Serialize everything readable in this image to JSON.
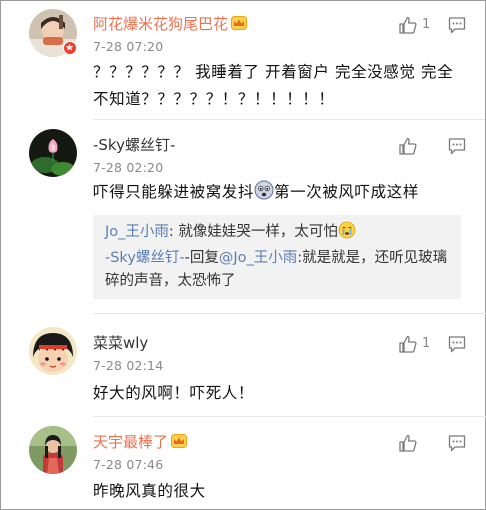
{
  "comments": [
    {
      "user": "阿花爆米花狗尾巴花",
      "time": "7-28 07:20",
      "text": "？？？？？？ 我睡着了 开着窗户 完全没感觉 完全不知道？？？？？！？！！！！！",
      "likes": "1",
      "name_color": "#eb7350"
    },
    {
      "user": "-Sky螺丝钉-",
      "time": "7-28 02:20",
      "text_before": "吓得只能躲进被窝发抖",
      "text_after": "第一次被风吓成这样",
      "likes": "",
      "replies": [
        {
          "user": "Jo_王小雨",
          "sep": ": ",
          "text": "就像娃娃哭一样，太可怕"
        },
        {
          "user": "-Sky螺丝钉-",
          "mid": "-回复",
          "target": "@Jo_王小雨",
          "text": ":就是就是，还听见玻璃碎的声音，太恐怖了"
        }
      ]
    },
    {
      "user": "菜菜wly",
      "time": "7-28 02:14",
      "text": "好大的风啊！吓死人！",
      "likes": "1"
    },
    {
      "user": "天宇最棒了",
      "time": "7-28 07:46",
      "text": "昨晚风真的很大",
      "likes": "",
      "name_color": "#eb7350"
    }
  ],
  "icons": {
    "like": "thumbs-up-icon",
    "reply": "comment-bubble-icon",
    "member": "crown-icon",
    "verified": "verified-badge-icon"
  },
  "colors": {
    "username_vip": "#eb7350",
    "mention": "#5b7fb5",
    "quote_bg": "#f2f2f2",
    "meta": "#8a8a8a"
  }
}
